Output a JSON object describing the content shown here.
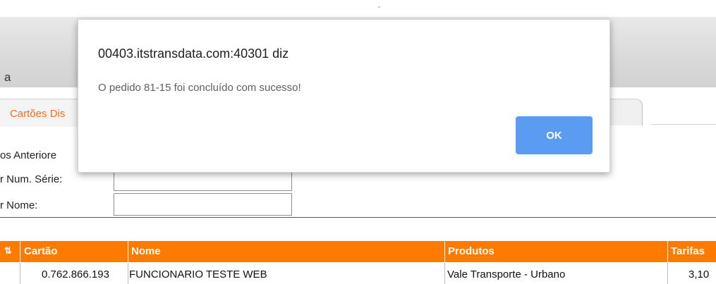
{
  "header": {
    "text_fragment": "a"
  },
  "tabs": {
    "active_label": "Cartões Dis"
  },
  "filters": {
    "anteriores_label": "os Anteriore",
    "serie_label": "r Num. Série:",
    "nome_label": "r Nome:",
    "serie_value": "",
    "nome_value": ""
  },
  "table": {
    "headers": [
      "Cartão",
      "Nome",
      "Produtos",
      "Tarifas"
    ],
    "rows": [
      {
        "cartao": "0.762.866.193",
        "nome": "FUNCIONARIO TESTE WEB",
        "produtos": "Vale Transporte - Urbano",
        "tarifas": "3,10"
      }
    ]
  },
  "dialog": {
    "title": "00403.itstransdata.com:40301 diz",
    "message": "O pedido 81-15 foi concluído com sucesso!",
    "ok_label": "OK"
  },
  "colors": {
    "accent_orange": "#ff7a00",
    "button_blue": "#5b9cf3"
  }
}
